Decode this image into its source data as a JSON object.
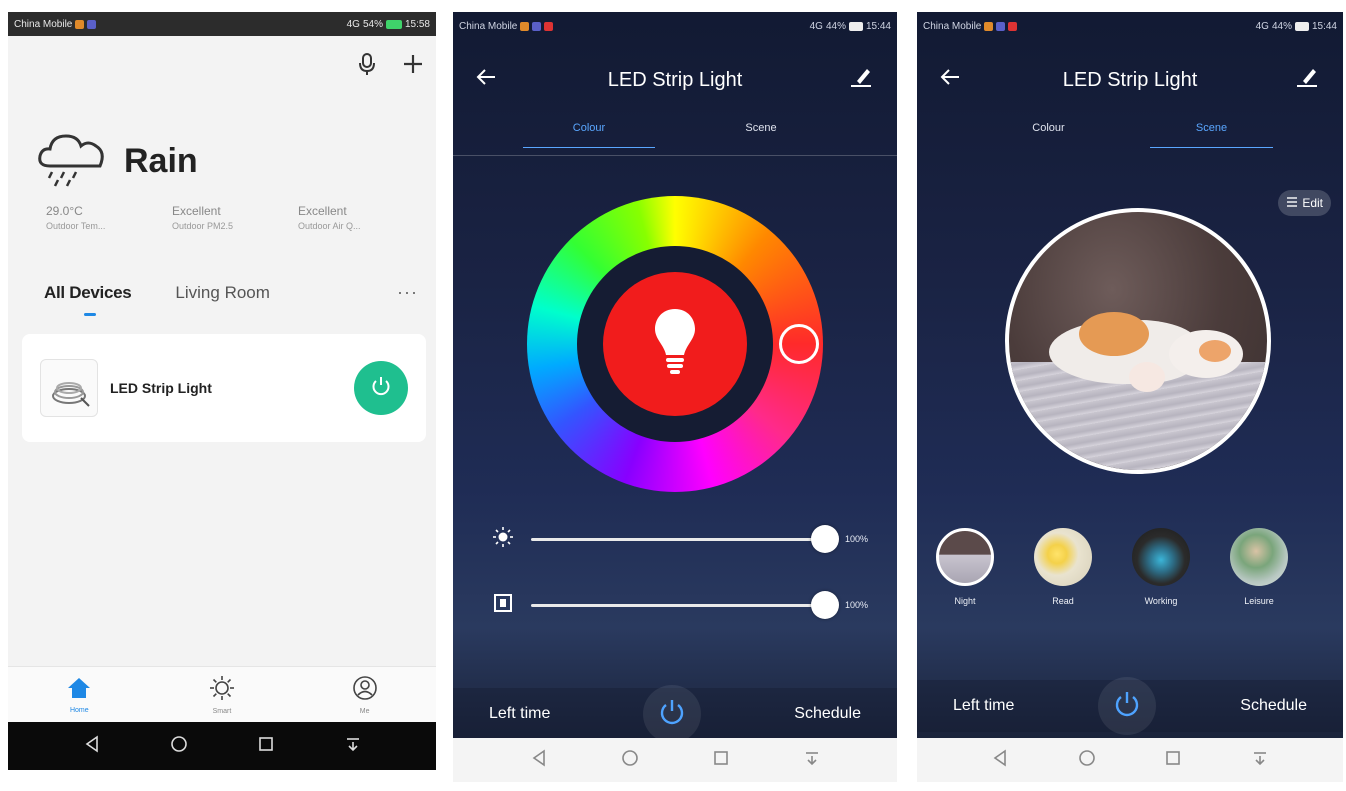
{
  "home": {
    "status": {
      "carrier": "China Mobile",
      "signal": "4G",
      "battery": "54%",
      "time": "15:58"
    },
    "weather": {
      "condition": "Rain"
    },
    "stats": [
      {
        "value": "29.0°C",
        "label": "Outdoor Tem..."
      },
      {
        "value": "Excellent",
        "label": "Outdoor PM2.5"
      },
      {
        "value": "Excellent",
        "label": "Outdoor Air Q..."
      }
    ],
    "tabs": [
      "All Devices",
      "Living Room"
    ],
    "more": "···",
    "device": {
      "name": "LED Strip Light"
    },
    "nav": [
      "Home",
      "Smart",
      "Me"
    ]
  },
  "colour_screen": {
    "status": {
      "carrier": "China Mobile",
      "signal": "4G",
      "battery": "44%",
      "time": "15:44"
    },
    "title": "LED Strip Light",
    "tabs": [
      "Colour",
      "Scene"
    ],
    "brightness": {
      "value": 1.0,
      "label": "100%"
    },
    "temperature": {
      "value": 1.0,
      "label": "100%"
    },
    "left_time": "Left time",
    "schedule": "Schedule"
  },
  "scene_screen": {
    "status": {
      "carrier": "China Mobile",
      "signal": "4G",
      "battery": "44%",
      "time": "15:44"
    },
    "title": "LED Strip Light",
    "tabs": [
      "Colour",
      "Scene"
    ],
    "edit": "Edit",
    "scenes": [
      "Night",
      "Read",
      "Working",
      "Leisure"
    ],
    "left_time": "Left time",
    "schedule": "Schedule"
  },
  "colors": {
    "accent": "#1E88E5",
    "power_green": "#1FBF8F",
    "bulb_red": "#F11C1C"
  }
}
